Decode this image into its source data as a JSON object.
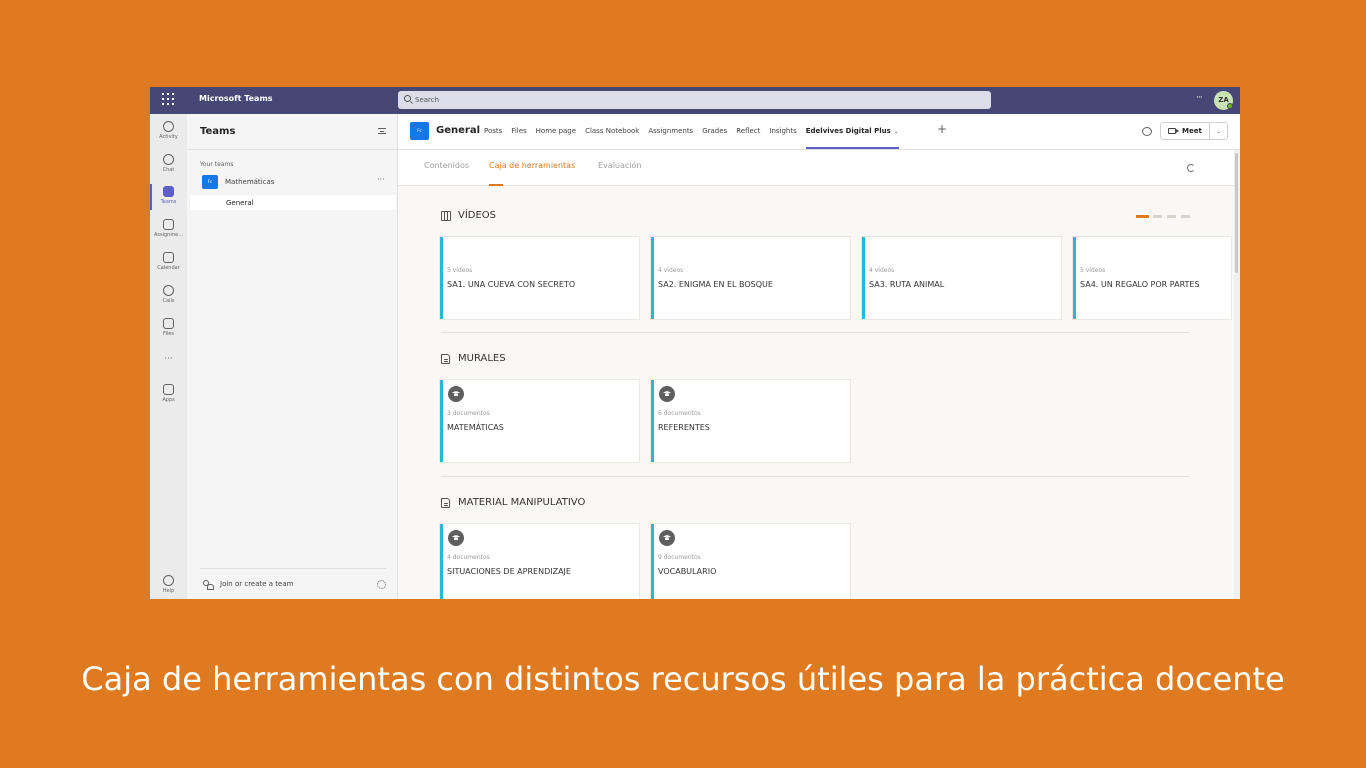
{
  "titlebar": {
    "app_name": "Microsoft Teams",
    "search_placeholder": "Search",
    "more": "···",
    "avatar_initials": "ZA"
  },
  "appbar": {
    "items": [
      {
        "label": "Activity",
        "icon": "bell-icon"
      },
      {
        "label": "Chat",
        "icon": "chat-icon"
      },
      {
        "label": "Teams",
        "icon": "teams-icon",
        "active": true
      },
      {
        "label": "Assignme...",
        "icon": "assignments-icon"
      },
      {
        "label": "Calendar",
        "icon": "calendar-icon"
      },
      {
        "label": "Calls",
        "icon": "phone-icon"
      },
      {
        "label": "Files",
        "icon": "file-icon"
      },
      {
        "label": "Apps",
        "icon": "apps-icon"
      },
      {
        "label": "Help",
        "icon": "help-icon"
      }
    ],
    "more": "···"
  },
  "panel": {
    "title": "Teams",
    "your_teams": "Your teams",
    "team": {
      "tile": "Fc",
      "name": "Mathemáticas",
      "more": "···"
    },
    "channel": "General",
    "join": "Join or create a team"
  },
  "channel_header": {
    "tile": "Fc",
    "title": "General",
    "tabs": [
      "Posts",
      "Files",
      "Home page",
      "Class Notebook",
      "Assignments",
      "Grades",
      "Reflect",
      "Insights"
    ],
    "active_tab": "Edelvives Digital Plus",
    "add": "+",
    "meet": "Meet",
    "meet_chevron": "⌄"
  },
  "subnav": {
    "tabs": [
      "Contenidos",
      "Caja de herramientas",
      "Evaluación"
    ],
    "active_index": 1
  },
  "sections": {
    "videos": {
      "title": "VÍDEOS",
      "cards": [
        {
          "count": "5 vídeos",
          "title": "SA1. UNA CUEVA CON SECRETO"
        },
        {
          "count": "4 vídeos",
          "title": "SA2. ENIGMA EN EL BOSQUE"
        },
        {
          "count": "4 vídeos",
          "title": "SA3. RUTA ANIMAL"
        },
        {
          "count": "5 vídeos",
          "title": "SA4. UN REGALO POR PARTES"
        }
      ]
    },
    "murales": {
      "title": "MURALES",
      "cards": [
        {
          "count": "3 documentos",
          "title": "MATEMÁTICAS"
        },
        {
          "count": "6 documentos",
          "title": "REFERENTES"
        }
      ]
    },
    "material": {
      "title": "MATERIAL MANIPULATIVO",
      "cards": [
        {
          "count": "4 documentos",
          "title": "SITUACIONES DE APRENDIZAJE"
        },
        {
          "count": "9 documentos",
          "title": "VOCABULARIO"
        }
      ]
    }
  },
  "colors": {
    "accent": "#e07a20",
    "teams_purple": "#464775",
    "card_border": "#2cb5d9"
  },
  "caption": "Caja de herramientas con distintos recursos útiles para la práctica docente"
}
